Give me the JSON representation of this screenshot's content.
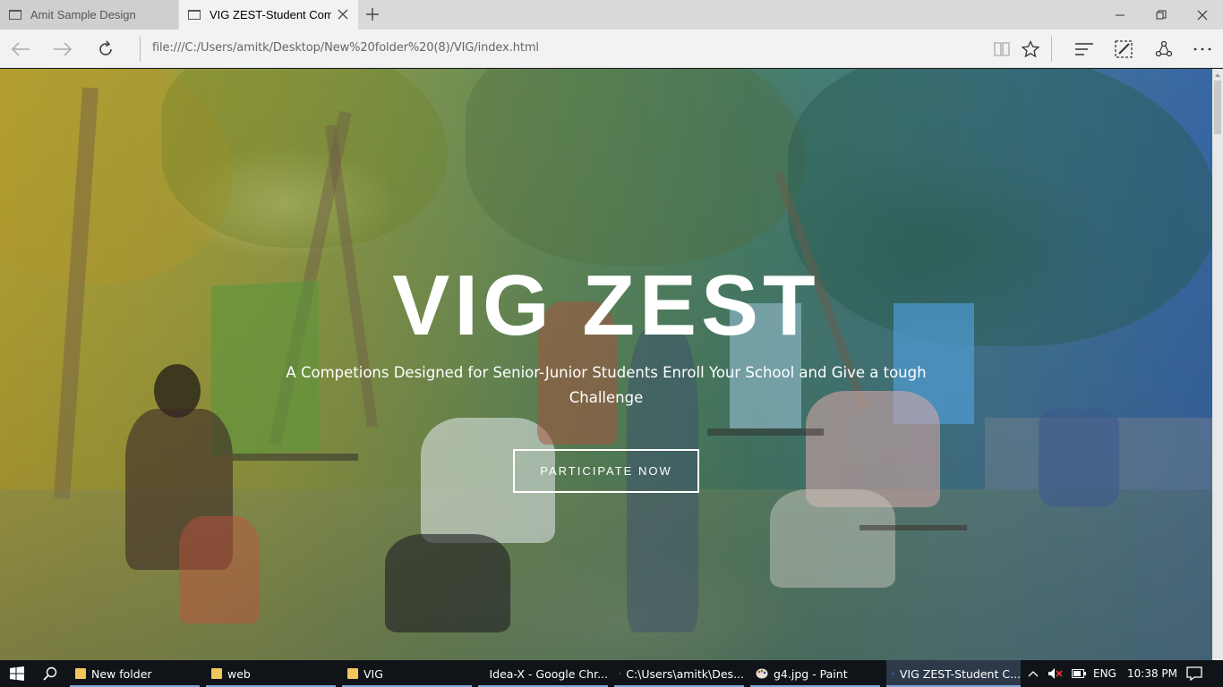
{
  "browser": {
    "tabs": [
      {
        "label": "Amit Sample Design",
        "active": false
      },
      {
        "label": "VIG ZEST-Student Comp",
        "active": true
      }
    ],
    "url": "file:///C:/Users/amitk/Desktop/New%20folder%20(8)/VIG/index.html"
  },
  "hero": {
    "title": "VIG ZEST",
    "subtitle": "A Competions Designed for Senior-Junior Students Enroll Your School and Give a tough Challenge",
    "cta_label": "PARTICIPATE NOW"
  },
  "taskbar": {
    "items": [
      {
        "label": "New folder",
        "icon": "folder-icon"
      },
      {
        "label": "web",
        "icon": "folder-icon"
      },
      {
        "label": "VIG",
        "icon": "folder-icon"
      },
      {
        "label": "Idea-X - Google Chr...",
        "icon": "chrome-icon"
      },
      {
        "label": "C:\\Users\\amitk\\Des...",
        "icon": "notepad-icon"
      },
      {
        "label": "g4.jpg - Paint",
        "icon": "paint-icon"
      },
      {
        "label": "VIG ZEST-Student C...",
        "icon": "edge-icon"
      }
    ],
    "language": "ENG",
    "time": "10:38 PM"
  }
}
